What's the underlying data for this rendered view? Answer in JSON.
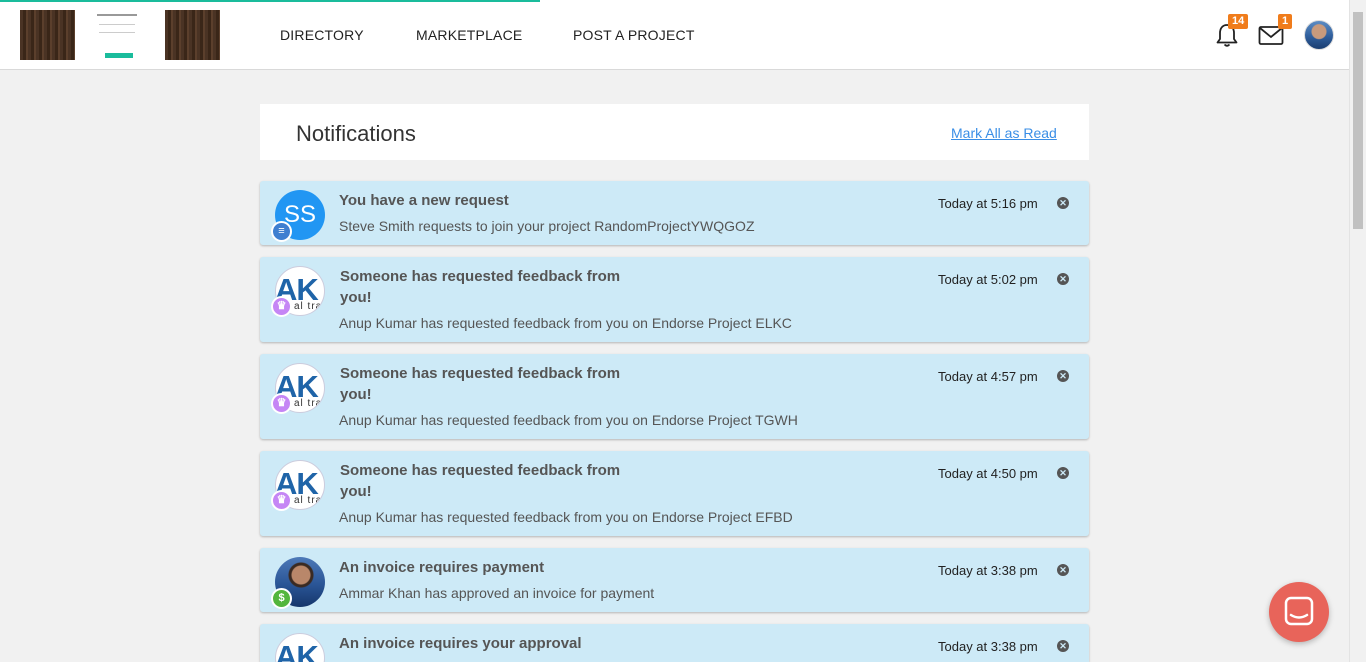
{
  "header": {
    "nav": [
      "DIRECTORY",
      "MARKETPLACE",
      "POST A PROJECT"
    ],
    "notifications_count": "14",
    "messages_count": "1"
  },
  "page": {
    "title": "Notifications",
    "mark_all": "Mark All as Read"
  },
  "notifications": [
    {
      "title": "You have a new request",
      "description": "Steve Smith requests to join your project RandomProjectYWQGOZ",
      "time": "Today at 5:16 pm",
      "avatar_text": "SS",
      "badge_icon": "list-icon"
    },
    {
      "title": "Someone has requested feedback from you!",
      "description": "Anup Kumar has requested feedback from you on Endorse Project ELKC",
      "time": "Today at 5:02 pm",
      "avatar_text": "AK",
      "badge_icon": "trophy-icon"
    },
    {
      "title": "Someone has requested feedback from you!",
      "description": "Anup Kumar has requested feedback from you on Endorse Project TGWH",
      "time": "Today at 4:57 pm",
      "avatar_text": "AK",
      "badge_icon": "trophy-icon"
    },
    {
      "title": "Someone has requested feedback from you!",
      "description": "Anup Kumar has requested feedback from you on Endorse Project EFBD",
      "time": "Today at 4:50 pm",
      "avatar_text": "AK",
      "badge_icon": "trophy-icon"
    },
    {
      "title": "An invoice requires payment",
      "description": "Ammar Khan has approved an invoice for payment",
      "time": "Today at 3:38 pm",
      "avatar_text": "",
      "badge_icon": "dollar-icon"
    },
    {
      "title": "An invoice requires your approval",
      "description": "",
      "time": "Today at 3:38 pm",
      "avatar_text": "AK",
      "badge_icon": ""
    }
  ],
  "colors": {
    "accent": "#1abc9c",
    "badge": "#f07c1b",
    "notification_bg": "#cdeaf7",
    "link": "#3a8ee6",
    "chat": "#e8645a"
  }
}
